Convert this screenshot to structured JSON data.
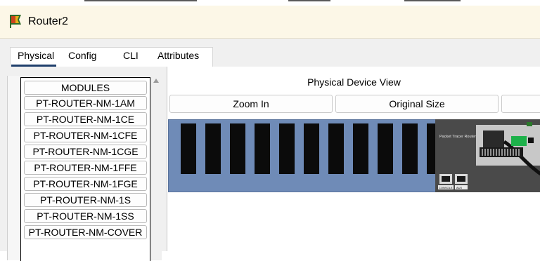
{
  "window": {
    "title": "Router2",
    "icon": "router-app-icon"
  },
  "tabs": [
    {
      "label": "Physical",
      "active": true
    },
    {
      "label": "Config"
    },
    {
      "label": "CLI"
    },
    {
      "label": "Attributes"
    }
  ],
  "modules": {
    "header": "MODULES",
    "items": [
      "PT-ROUTER-NM-1AM",
      "PT-ROUTER-NM-1CE",
      "PT-ROUTER-NM-1CFE",
      "PT-ROUTER-NM-1CGE",
      "PT-ROUTER-NM-1FFE",
      "PT-ROUTER-NM-1FGE",
      "PT-ROUTER-NM-1S",
      "PT-ROUTER-NM-1SS",
      "PT-ROUTER-NM-COVER"
    ]
  },
  "device_view": {
    "label": "Physical Device View",
    "zoom_in": "Zoom In",
    "original_size": "Original Size",
    "router_brand": "Packet Tracer Router",
    "ports": [
      "CONSOLE",
      "AUX"
    ]
  },
  "colors": {
    "router_body": "#6f8bb7",
    "slot": "#0b0b0b",
    "titlebar": "#fcf7e7",
    "tab_underline": "#1f3f6b"
  }
}
